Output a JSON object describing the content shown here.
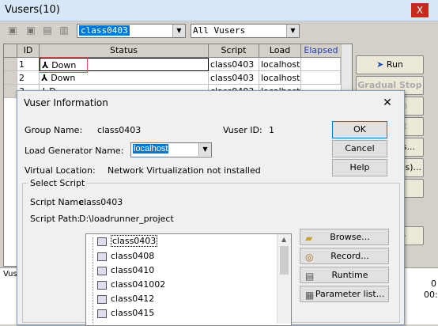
{
  "vusers_window": {
    "title": "Vusers(10)",
    "close_glyph": "X",
    "group_filter": "class0403",
    "vuser_filter": "All Vusers",
    "columns": [
      "ID",
      "Status",
      "Script",
      "Load Generator",
      "Elapsed Time"
    ],
    "rows": [
      {
        "id": "1",
        "status": "Down",
        "script": "class0403",
        "load_generator": "localhost"
      },
      {
        "id": "2",
        "status": "Down",
        "script": "class0403",
        "load_generator": "localhost"
      },
      {
        "id": "3",
        "status": "D",
        "script": "class0403",
        "load_generator": "localhost"
      }
    ],
    "side_buttons": [
      "Run",
      "Gradual Stop",
      "p",
      "set",
      "ils...",
      "user(s)...",
      "h",
      "p"
    ],
    "bottom_label": "Vus",
    "right_edge_text": [
      "0",
      "00:0"
    ]
  },
  "dialog": {
    "title": "Vuser Information",
    "group_name_label": "Group Name:",
    "group_name_value": "class0403",
    "vuser_id_label": "Vuser ID:",
    "vuser_id_value": "1",
    "load_gen_label": "Load Generator Name:",
    "load_gen_value": "localhost",
    "virtual_location_label": "Virtual Location:",
    "virtual_location_value": "Network Virtualization not installed",
    "ok_label": "OK",
    "cancel_label": "Cancel",
    "help_label": "Help",
    "select_script_label": "Select Script",
    "script_name_label": "Script Name:",
    "script_name_value": "class0403",
    "script_path_label": "Script Path:",
    "script_path_value": "D:\\loadrunner_project",
    "scripts": [
      "class0403",
      "class0408",
      "class0410",
      "class041002",
      "class0412",
      "class0415"
    ],
    "browse_label": "Browse...",
    "record_label": "Record...",
    "runtime_label": "Runtime Settings...",
    "param_label": "Parameter list..."
  },
  "colors": {
    "selection": "#0078d7",
    "highlight_border": "#d9534f"
  }
}
